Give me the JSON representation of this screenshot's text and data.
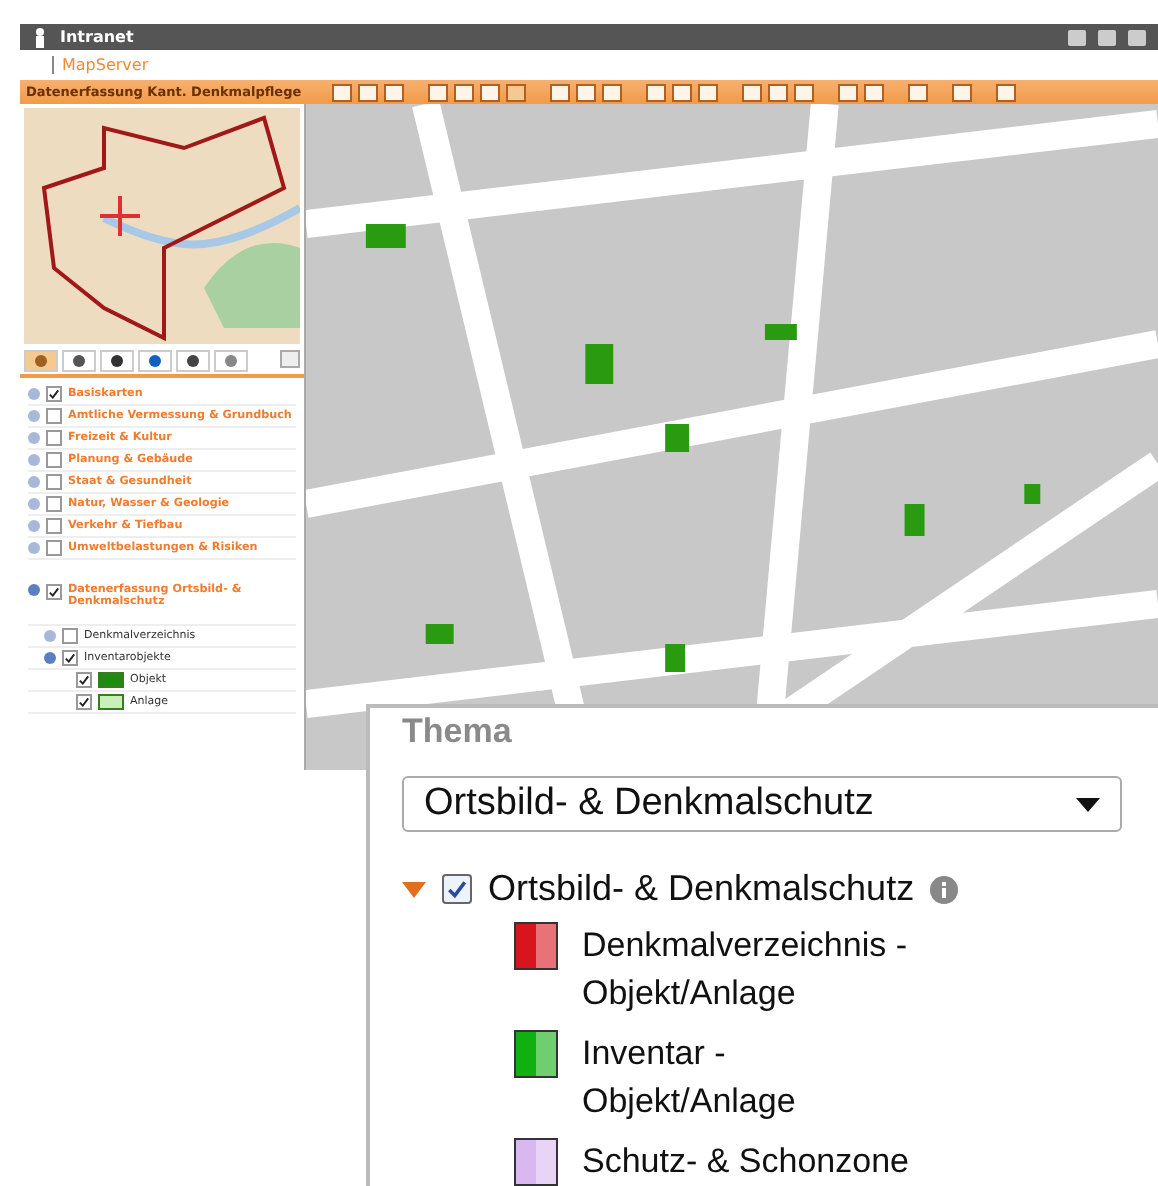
{
  "top_bar": {
    "title": "Intranet"
  },
  "app": {
    "title": "MapServer"
  },
  "toolbar": {
    "title": "Datenerfassung Kant. Denkmalpflege"
  },
  "panel_tabs": [
    {
      "selected": true
    },
    {
      "selected": false
    },
    {
      "selected": false
    },
    {
      "selected": false
    },
    {
      "selected": false
    },
    {
      "selected": false
    }
  ],
  "layers": [
    {
      "label": "Basiskarten",
      "checked": true,
      "expanded": false
    },
    {
      "label": "Amtliche Vermessung & Grundbuch",
      "checked": false,
      "expanded": false
    },
    {
      "label": "Freizeit & Kultur",
      "checked": false,
      "expanded": false
    },
    {
      "label": "Planung & Gebäude",
      "checked": false,
      "expanded": false
    },
    {
      "label": "Staat & Gesundheit",
      "checked": false,
      "expanded": false
    },
    {
      "label": "Natur, Wasser & Geologie",
      "checked": false,
      "expanded": false
    },
    {
      "label": "Verkehr & Tiefbau",
      "checked": false,
      "expanded": false
    },
    {
      "label": "Umweltbelastungen & Risiken",
      "checked": false,
      "expanded": false
    }
  ],
  "edit_layer": {
    "label": "Datenerfassung Ortsbild- & Denkmalschutz",
    "checked": true,
    "expanded": true,
    "children": [
      {
        "label": "Denkmalverzeichnis",
        "checked": false
      },
      {
        "label": "Inventarobjekte",
        "checked": true,
        "children": [
          {
            "label": "Objekt",
            "checked": true,
            "color": "#1f8a10"
          },
          {
            "label": "Anlage",
            "checked": true,
            "color": "#c8f0b8"
          }
        ]
      }
    ]
  },
  "inset": {
    "heading": "Thema",
    "select_value": "Ortsbild- & Denkmalschutz",
    "theme": {
      "label": "Ortsbild- & Denkmalschutz",
      "checked": true,
      "expanded": true
    },
    "legend": [
      {
        "label": "Denkmalverzeichnis -\nObjekt/Anlage",
        "color": "#d8141e"
      },
      {
        "label": "Inventar -\nObjekt/Anlage",
        "color": "#10b010"
      },
      {
        "label": "Schutz- & Schonzone",
        "color": "#d9b8f0"
      }
    ]
  }
}
